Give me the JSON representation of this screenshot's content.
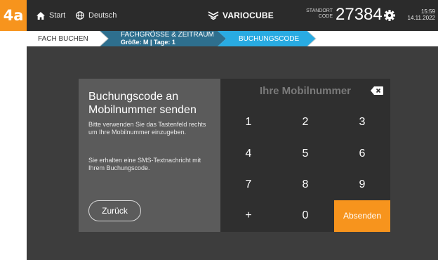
{
  "step_badge": "4a",
  "topbar": {
    "home_label": "Start",
    "language_label": "Deutsch",
    "brand": "VARIOCUBE",
    "standort_label_1": "STANDORT",
    "standort_label_2": "CODE",
    "standort_code": "27384",
    "time": "15:59",
    "date": "14.11.2022"
  },
  "breadcrumb": {
    "step1": "FACH BUCHEN",
    "step2_line1": "FACHGRÖSSE & ZEITRAUM",
    "step2_line2": "Größe: M | Tage: 1",
    "step3": "BUCHUNGSCODE"
  },
  "panel": {
    "title": "Buchungscode an Mobilnummer senden",
    "instruction": "Bitte verwenden Sie das Tastenfeld rechts um Ihre Mobilnummer einzugeben.",
    "info": "Sie erhalten eine SMS-Textnachricht mit Ihrem Buchungscode.",
    "back_label": "Zurück"
  },
  "keypad": {
    "placeholder": "Ihre Mobilnummer",
    "keys": [
      "1",
      "2",
      "3",
      "4",
      "5",
      "6",
      "7",
      "8",
      "9",
      "+",
      "0"
    ],
    "send_label": "Absenden"
  },
  "colors": {
    "accent": "#f7941d",
    "step_active": "#29abe2",
    "step_done": "#2e6f8e"
  }
}
